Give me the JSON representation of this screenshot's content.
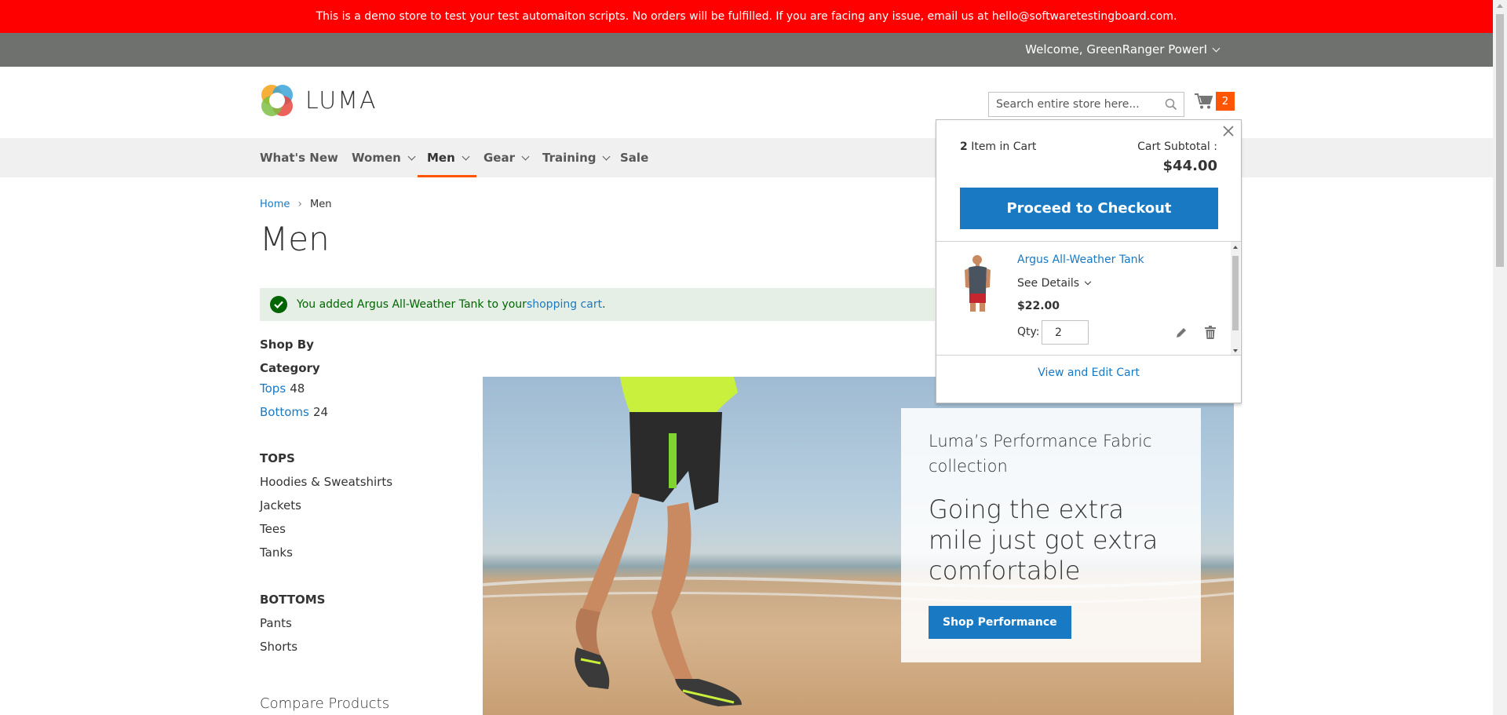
{
  "banner": {
    "text": "This is a demo store to test your test automaiton scripts. No orders will be fulfilled. If you are facing any issue, email us at hello@softwaretestingboard.com."
  },
  "header": {
    "welcome": "Welcome, GreenRanger PowerI",
    "logo_text": "LUMA",
    "search_placeholder": "Search entire store here...",
    "cart_count": "2"
  },
  "nav": {
    "items": [
      {
        "label": "What's New"
      },
      {
        "label": "Women"
      },
      {
        "label": "Men"
      },
      {
        "label": "Gear"
      },
      {
        "label": "Training"
      },
      {
        "label": "Sale"
      }
    ]
  },
  "breadcrumb": {
    "home": "Home",
    "current": "Men"
  },
  "page": {
    "title": "Men"
  },
  "message": {
    "prefix": "You added Argus All-Weather Tank to your ",
    "link": "shopping cart",
    "suffix": "."
  },
  "sidebar": {
    "shop_by": "Shop By",
    "category_title": "Category",
    "categories": [
      {
        "label": "Tops",
        "count": "48"
      },
      {
        "label": "Bottoms",
        "count": "24"
      }
    ],
    "tops_heading": "TOPS",
    "tops": [
      "Hoodies & Sweatshirts",
      "Jackets",
      "Tees",
      "Tanks"
    ],
    "bottoms_heading": "BOTTOMS",
    "bottoms": [
      "Pants",
      "Shorts"
    ],
    "compare_title": "Compare Products"
  },
  "hero": {
    "subtitle": "Luma’s Performance Fabric collection",
    "headline": "Going the extra mile just got extra comfortable",
    "button": "Shop Performance"
  },
  "minicart": {
    "count": "2",
    "count_suffix": " Item in Cart",
    "subtotal_label": "Cart Subtotal :",
    "subtotal": "$44.00",
    "checkout": "Proceed to Checkout",
    "item": {
      "name": "Argus All-Weather Tank",
      "details": "See Details",
      "price": "$22.00",
      "qty_label": "Qty:",
      "qty": "2"
    },
    "view_edit": "View and Edit Cart"
  },
  "colors": {
    "banner": "#ff0000",
    "accent": "#ff5501",
    "primary": "#1979c3",
    "success": "#006400"
  }
}
